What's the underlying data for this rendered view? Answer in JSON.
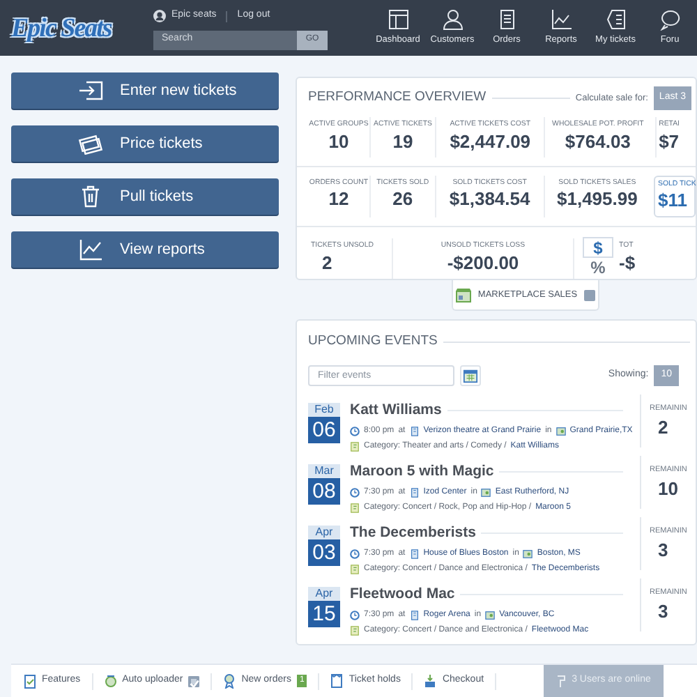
{
  "header": {
    "logo": "Epic Seats",
    "user": "Epic seats",
    "logout": "Log out",
    "search": {
      "placeholder": "Search",
      "button": "GO"
    },
    "nav": [
      {
        "label": "Dashboard",
        "kind": "dashboard",
        "selected": false
      },
      {
        "label": "Customers",
        "kind": "customers",
        "selected": false
      },
      {
        "label": "Orders",
        "kind": "orders",
        "selected": false
      },
      {
        "label": "Reports",
        "kind": "reports",
        "selected": false
      },
      {
        "label": "My tickets",
        "kind": "tickets",
        "selected": false
      },
      {
        "label": "Foru",
        "kind": "forum",
        "selected": false
      }
    ]
  },
  "actions": [
    {
      "label": "Enter new tickets",
      "kind": "enter"
    },
    {
      "label": "Price tickets",
      "kind": "price"
    },
    {
      "label": "Pull tickets",
      "kind": "pull"
    },
    {
      "label": "View reports",
      "kind": "view"
    }
  ],
  "performance": {
    "title": "PERFORMANCE OVERVIEW",
    "calc_label": "Calculate sale for:",
    "period": "Last 3",
    "rows": [
      [
        {
          "label": "ACTIVE GROUPS",
          "value": "10",
          "selected": false
        },
        {
          "label": "ACTIVE TICKETS",
          "value": "19",
          "selected": false
        },
        {
          "label": "ACTIVE TICKETS COST",
          "value": "$2,447.09",
          "selected": false
        },
        {
          "label": "WHOLESALE POT. PROFIT",
          "value": "$764.03",
          "selected": false
        },
        {
          "label": "RETAI",
          "value": "$7",
          "selected": false
        }
      ],
      [
        {
          "label": "ORDERS COUNT",
          "value": "12",
          "selected": false
        },
        {
          "label": "TICKETS SOLD",
          "value": "26",
          "selected": false
        },
        {
          "label": "SOLD TICKETS COST",
          "value": "$1,384.54",
          "selected": false
        },
        {
          "label": "SOLD TICKETS SALES",
          "value": "$1,495.99",
          "selected": false
        },
        {
          "label": "SOLD TICK",
          "value": "$11",
          "selected": true
        }
      ]
    ],
    "unsold": {
      "label": "TICKETS UNSOLD",
      "value": "2"
    },
    "loss": {
      "label": "UNSOLD TICKETS LOSS",
      "value": "-$200.00"
    },
    "mode": [
      {
        "label": "$",
        "selected": true
      },
      {
        "label": "%",
        "selected": false
      }
    ],
    "total": {
      "label": "TOT",
      "value": "-$"
    },
    "tab": "MARKETPLACE SALES"
  },
  "events": {
    "title": "UPCOMING EVENTS",
    "filter_placeholder": "Filter events",
    "showing_label": "Showing:",
    "showing_value": "10",
    "items": [
      {
        "month": "Feb",
        "day": "06",
        "name": "Katt Williams",
        "time": "8:00 pm",
        "at": "at",
        "venue": "Verizon theatre at Grand Prairie",
        "in": "in",
        "city": "Grand Prairie,TX",
        "category": "Category: Theater and arts / Comedy /",
        "category_link": "Katt Williams",
        "remaining_label": "REMAININ",
        "remaining": "2"
      },
      {
        "month": "Mar",
        "day": "08",
        "name": "Maroon 5 with Magic",
        "time": "7:30 pm",
        "at": "at",
        "venue": "Izod Center",
        "in": "in",
        "city": "East Rutherford, NJ",
        "category": "Category: Concert / Rock, Pop and Hip-Hop /",
        "category_link": "Maroon 5",
        "remaining_label": "REMAININ",
        "remaining": "10"
      },
      {
        "month": "Apr",
        "day": "03",
        "name": "The Decemberists",
        "time": "7:30 pm",
        "at": "at",
        "venue": "House of Blues Boston",
        "in": "in",
        "city": "Boston, MS",
        "category": "Category: Concert / Dance and Electronica /",
        "category_link": "The Decemberists",
        "remaining_label": "REMAININ",
        "remaining": "3"
      },
      {
        "month": "Apr",
        "day": "15",
        "name": "Fleetwood Mac",
        "time": "7:30 pm",
        "at": "at",
        "venue": "Roger Arena",
        "in": "in",
        "city": "Vancouver, BC",
        "category": "Category: Concert / Dance and Electronica /",
        "category_link": "Fleetwood Mac",
        "remaining_label": "REMAININ",
        "remaining": "3"
      }
    ]
  },
  "footer": {
    "items": [
      {
        "label": "Features",
        "kind": "features"
      },
      {
        "label": "Auto uploader",
        "kind": "uploader",
        "checked": true
      },
      {
        "label": "New orders",
        "kind": "orders",
        "badge": "1"
      },
      {
        "label": "Ticket holds",
        "kind": "holds"
      },
      {
        "label": "Checkout",
        "kind": "checkout"
      }
    ],
    "online": "3 Users are online"
  }
}
